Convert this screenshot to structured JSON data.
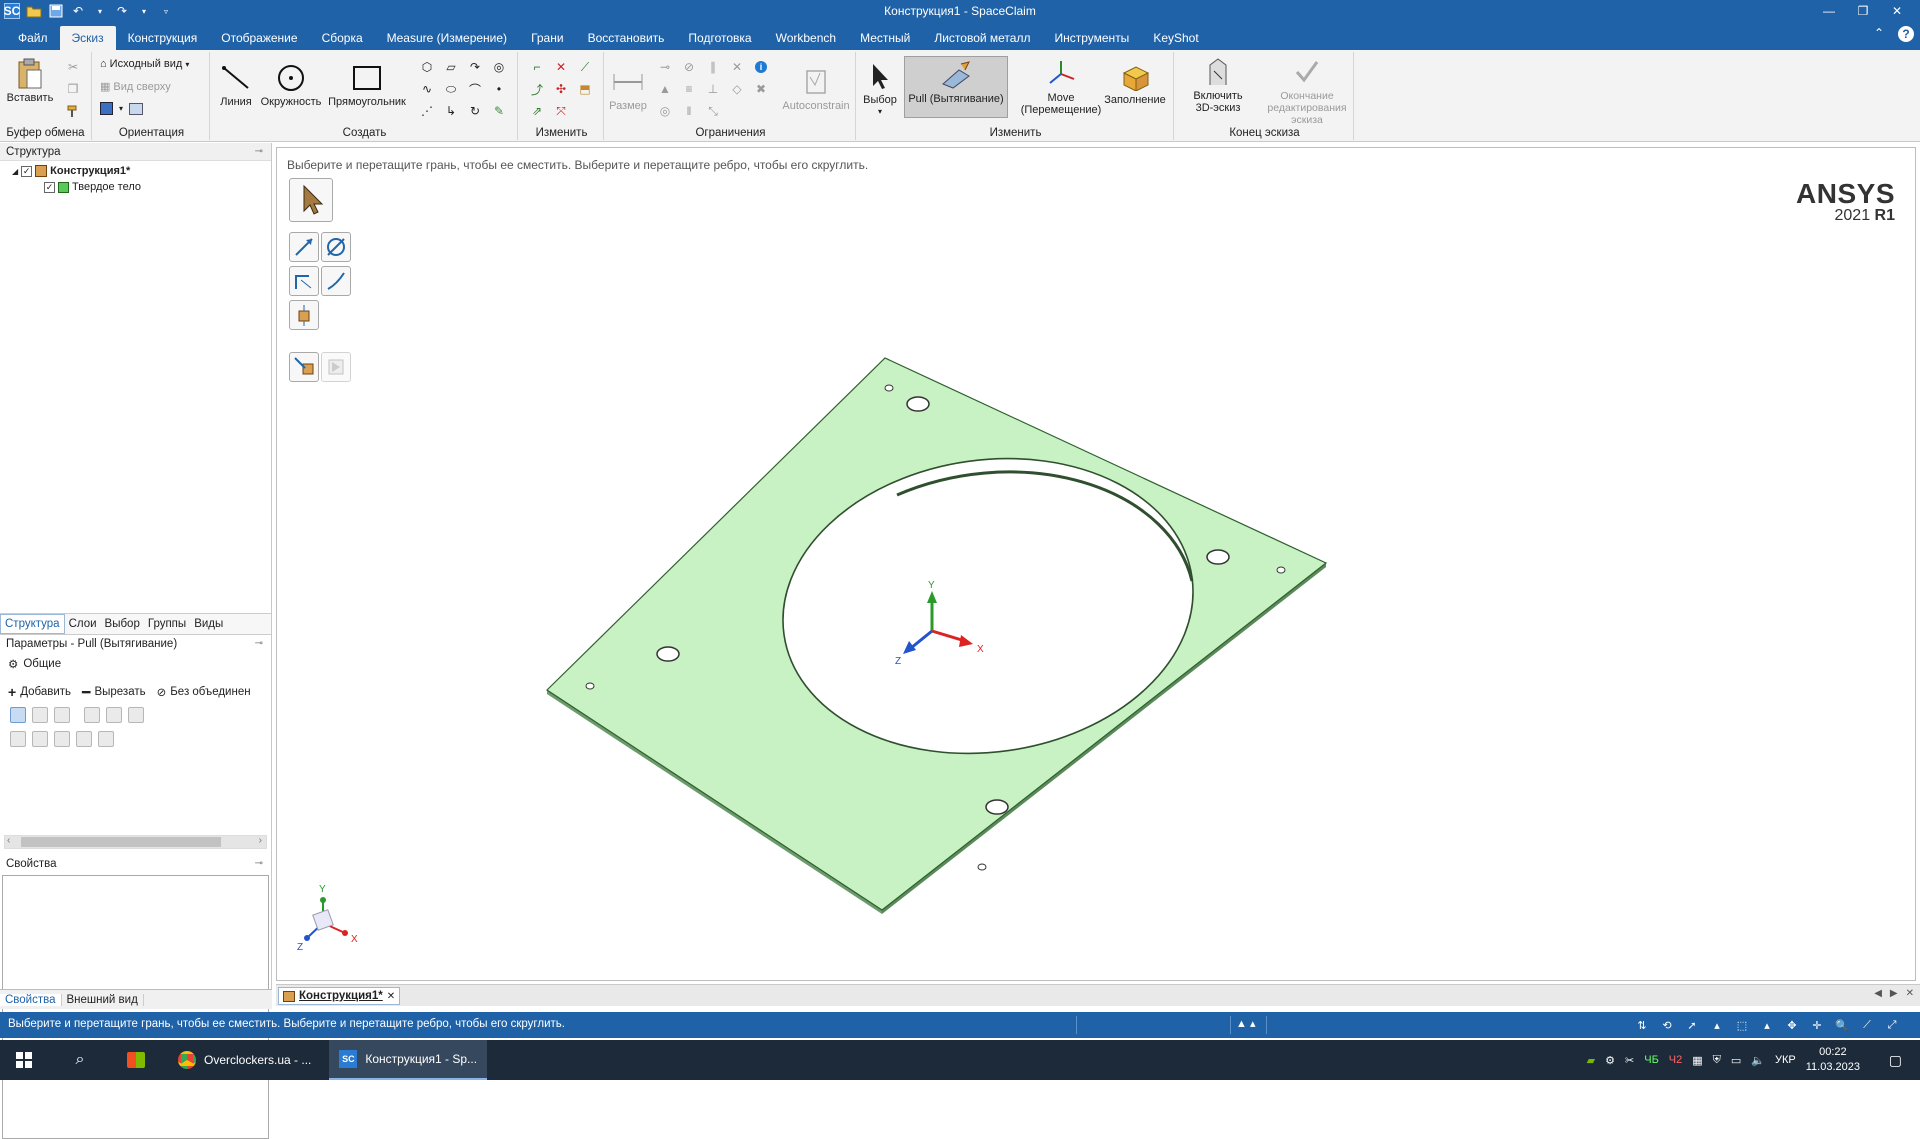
{
  "window": {
    "title": "Конструкция1 - SpaceClaim",
    "quick_access": [
      "sc-logo",
      "open-icon",
      "save-icon",
      "undo-icon",
      "redo-icon",
      "customize-icon"
    ],
    "controls": [
      "minimize",
      "restore",
      "close"
    ]
  },
  "menu": {
    "tabs": [
      "Файл",
      "Эскиз",
      "Конструкция",
      "Отображение",
      "Сборка",
      "Measure (Измерение)",
      "Грани",
      "Восстановить",
      "Подготовка",
      "Workbench",
      "Местный",
      "Листовой металл",
      "Инструменты",
      "KeyShot"
    ],
    "active": "Эскиз"
  },
  "ribbon": {
    "groups": [
      {
        "name": "clipboard",
        "label": "Буфер обмена",
        "paste": "Вставить"
      },
      {
        "name": "orientation",
        "label": "Ориентация",
        "home_view": "Исходный вид",
        "top_view": "Вид сверху"
      },
      {
        "name": "create",
        "label": "Создать",
        "line": "Линия",
        "circle": "Окружность",
        "rectangle": "Прямоугольник"
      },
      {
        "name": "modify",
        "label": "Изменить"
      },
      {
        "name": "constraints",
        "label": "Ограничения",
        "dimension": "Размер",
        "autoconstrain": "Autoconstrain"
      },
      {
        "name": "edit",
        "label": "Изменить",
        "select": "Выбор",
        "pull": "Pull (Вытягивание)",
        "move": "Move (Перемещение)",
        "fill": "Заполнение"
      },
      {
        "name": "end-sketch",
        "label": "Конец эскиза",
        "enable3d": "Включить 3D-эскиз",
        "finish": "Окончание редактирования эскиза"
      }
    ]
  },
  "structure": {
    "title": "Структура",
    "root": "Конструкция1*",
    "child": "Твердое тело",
    "tabs": [
      "Структура",
      "Слои",
      "Выбор",
      "Группы",
      "Виды"
    ]
  },
  "options": {
    "title": "Параметры - Pull (Вытягивание)",
    "general": "Общие",
    "add": "Добавить",
    "cut": "Вырезать",
    "no_merge": "Без объединен"
  },
  "properties": {
    "title": "Свойства",
    "tabs": [
      "Свойства",
      "Внешний вид"
    ]
  },
  "viewport": {
    "hint": "Выберите и перетащите грань, чтобы ее сместить. Выберите и перетащите ребро, чтобы его скруглить.",
    "logo_brand": "ANSYS",
    "logo_version_year": "2021",
    "logo_version_release": "R1",
    "axes": {
      "x": "X",
      "y": "Y",
      "z": "Z"
    },
    "plate_color": "#c8f2c4",
    "plate_edge_color": "#3a6e3a"
  },
  "document_tab": "Конструкция1*",
  "status": {
    "message": "Выберите и перетащите грань, чтобы ее сместить. Выберите и перетащите ребро, чтобы его скруглить."
  },
  "taskbar": {
    "tasks": [
      "Overclockers.ua - ...",
      "Конструкция1 - Sp..."
    ],
    "language": "УКР",
    "time": "00:22",
    "date": "11.03.2023",
    "tray_labels": [
      "ЧБ",
      "Ч2"
    ]
  }
}
